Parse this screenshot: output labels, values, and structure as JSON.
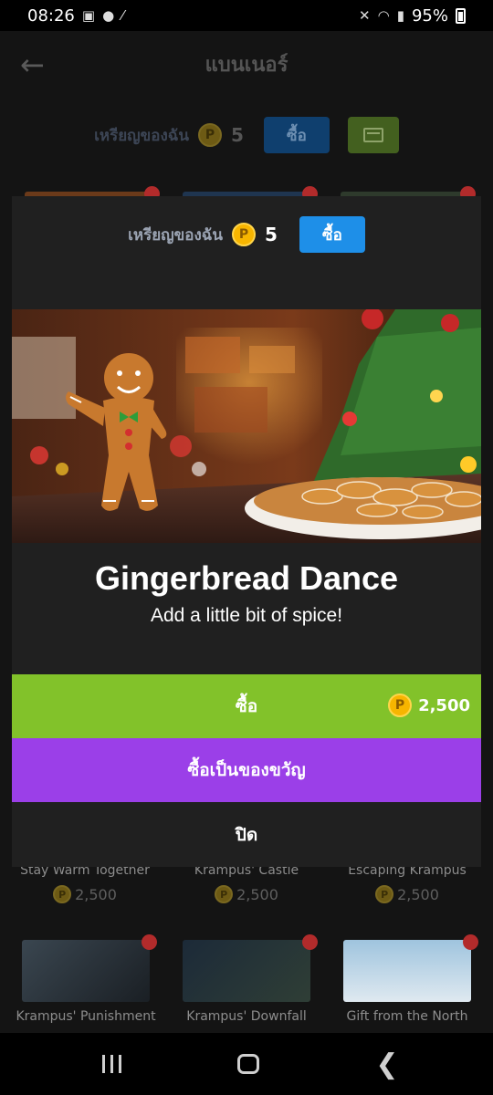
{
  "status_bar": {
    "time": "08:26",
    "battery": "95%"
  },
  "app": {
    "title": "แบนเนอร์",
    "my_coins_label": "เหรียญของฉัน",
    "coin_count": "5",
    "buy_label": "ซื้อ",
    "items_row1": [
      {
        "name": "Stay Warm Together",
        "price": "2,500"
      },
      {
        "name": "Krampus' Castle",
        "price": "2,500"
      },
      {
        "name": "Escaping Krampus",
        "price": "2,500"
      }
    ],
    "items_row2": [
      {
        "name": "Krampus' Punishment"
      },
      {
        "name": "Krampus' Downfall"
      },
      {
        "name": "Gift from the North"
      }
    ]
  },
  "dialog": {
    "my_coins_label": "เหรียญของฉัน",
    "coin_count": "5",
    "buy_label": "ซื้อ",
    "title": "Gingerbread Dance",
    "subtitle": "Add a little bit of spice!",
    "buy_button_label": "ซื้อ",
    "price": "2,500",
    "gift_button_label": "ซื้อเป็นของขวัญ",
    "close_label": "ปิด"
  },
  "colors": {
    "buy_bar": "#82c22a",
    "gift_bar": "#9b3fe8",
    "buy_button": "#1e8fe8",
    "coin": "#f7b500",
    "notification_dot": "#b22b2b"
  }
}
